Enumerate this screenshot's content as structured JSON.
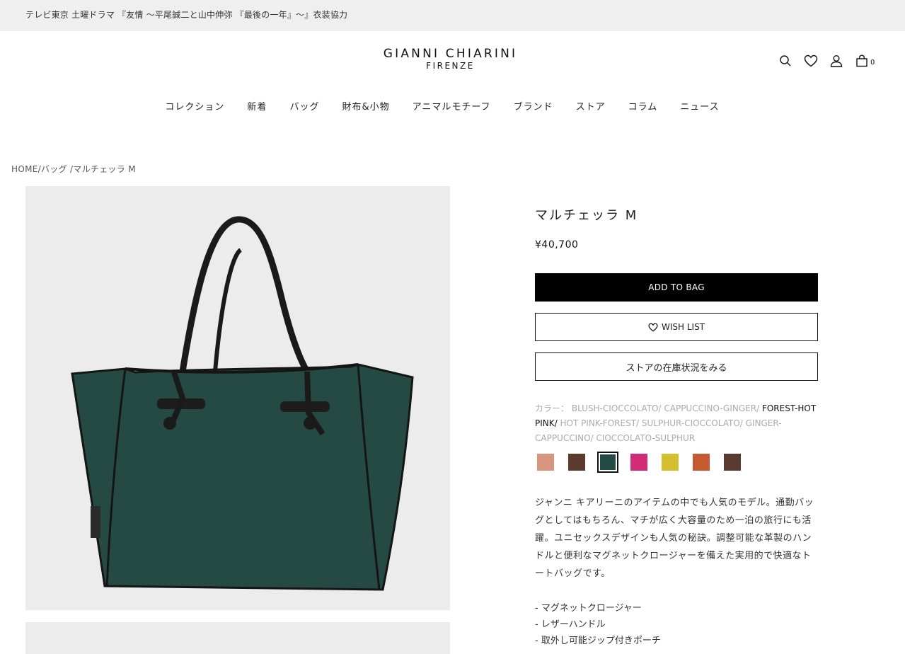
{
  "topbar": {
    "text": "テレビ東京 土曜ドラマ 『友情 〜平尾誠二と山中伸弥 『最後の一年』〜』衣装協力"
  },
  "logo": {
    "main": "GIANNI CHIARINI",
    "sub": "FIRENZE"
  },
  "header": {
    "cart_count": "0"
  },
  "nav": {
    "items": [
      "コレクション",
      "新着",
      "バッグ",
      "財布&小物",
      "アニマルモチーフ",
      "ブランド",
      "ストア",
      "コラム",
      "ニュース"
    ]
  },
  "breadcrumb": {
    "text": "HOME/バッグ /マルチェッラ M"
  },
  "product": {
    "title": "マルチェッラ M",
    "price": "¥40,700",
    "add_to_bag": "ADD TO BAG",
    "wish_list": "WISH LIST",
    "store_stock": "ストアの在庫状況をみる",
    "color_label": "カラー：",
    "color_options": [
      {
        "name": "BLUSH-CIOCCOLATO/",
        "selected": false
      },
      {
        "name": "CAPPUCCINO-GINGER/",
        "selected": false
      },
      {
        "name": "FOREST-HOT PINK/",
        "selected": true
      },
      {
        "name": "HOT PINK-FOREST/",
        "selected": false
      },
      {
        "name": "SULPHUR-CIOCCOLATO/",
        "selected": false
      },
      {
        "name": "GINGER-CAPPUCCINO/",
        "selected": false
      },
      {
        "name": "CIOCCOLATO-SULPHUR",
        "selected": false
      }
    ],
    "swatches": [
      "#d9957f",
      "#5d3a2e",
      "#244a45",
      "#d22c78",
      "#d4bf2c",
      "#c65a32",
      "#5a3a2e"
    ],
    "selected_swatch": 2,
    "description": "ジャンニ キアリーニのアイテムの中でも人気のモデル。通勤バッグとしてはもちろん、マチが広く大容量のため一泊の旅行にも活躍。ユニセックスデザインも人気の秘訣。調整可能な革製のハンドルと便利なマグネットクロージャーを備えた実用的で快適なトートバッグです。",
    "features": [
      "- マグネットクロージャー",
      "- レザーハンドル",
      "- 取外し可能ジップ付きポーチ"
    ]
  }
}
